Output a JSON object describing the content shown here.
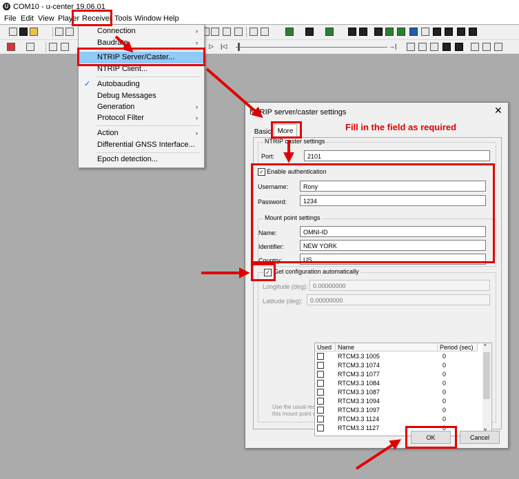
{
  "window": {
    "title": "COM10 - u-center 19.06.01",
    "logo_letter": "U"
  },
  "menubar": [
    "File",
    "Edit",
    "View",
    "Player",
    "Receiver",
    "Tools",
    "Window",
    "Help"
  ],
  "receiver_menu": {
    "items": [
      {
        "label": "Connection",
        "submenu": "›"
      },
      {
        "label": "Baudrate",
        "submenu": "›"
      },
      {
        "label": "NTRIP Server/Caster..."
      },
      {
        "label": "NTRIP Client..."
      },
      {
        "label": "Autobauding",
        "checked": "✓"
      },
      {
        "label": "Debug Messages"
      },
      {
        "label": "Generation",
        "submenu": "›"
      },
      {
        "label": "Protocol Filter",
        "submenu": "›"
      },
      {
        "label": "Action",
        "submenu": "›"
      },
      {
        "label": "Differential GNSS Interface..."
      },
      {
        "label": "Epoch detection..."
      }
    ]
  },
  "dialog": {
    "title": "NTRIP server/caster settings",
    "close": "✕",
    "tabs": [
      "Basic",
      "More"
    ],
    "caster": {
      "group_title": "NTRIP caster settings",
      "port_label": "Port:",
      "port_value": "2101"
    },
    "auth": {
      "enable_label": "Enable authentication",
      "enable_check": "✓",
      "username_label": "Username:",
      "username_value": "Rony",
      "password_label": "Password:",
      "password_value": "1234"
    },
    "mount": {
      "group_title": "Mount point settings",
      "name_label": "Name:",
      "name_value": "OMNI-ID",
      "identifier_label": "Identifier:",
      "identifier_value": "NEW YORK",
      "country_label": "Country:",
      "country_value": "US"
    },
    "config": {
      "auto_label": "Get configuration automatically",
      "auto_check": "✓",
      "longitude_label": "Longitude (deg):",
      "longitude_value": "0.00000000",
      "latitude_label": "Latitude (deg):",
      "latitude_value": "0.00000000"
    },
    "table": {
      "headers": [
        "Used",
        "Name",
        "Period (sec)"
      ],
      "rows": [
        {
          "name": "RTCM3.3 1005",
          "period": "0"
        },
        {
          "name": "RTCM3.3 1074",
          "period": "0"
        },
        {
          "name": "RTCM3.3 1077",
          "period": "0"
        },
        {
          "name": "RTCM3.3 1084",
          "period": "0"
        },
        {
          "name": "RTCM3.3 1087",
          "period": "0"
        },
        {
          "name": "RTCM3.3 1094",
          "period": "0"
        },
        {
          "name": "RTCM3.3 1097",
          "period": "0"
        },
        {
          "name": "RTCM3.3 1124",
          "period": "0"
        },
        {
          "name": "RTCM3.3 1127",
          "period": "0"
        }
      ],
      "scroll_up": "^",
      "scroll_down": "v"
    },
    "hint": "Use the usual receiver save configuration toolbar or menu options to permanently store this mount point configuration.",
    "ok": "OK",
    "cancel": "Cancel"
  },
  "annotation": {
    "instruction": "Fill in the field as required",
    "color": "#e00000"
  }
}
